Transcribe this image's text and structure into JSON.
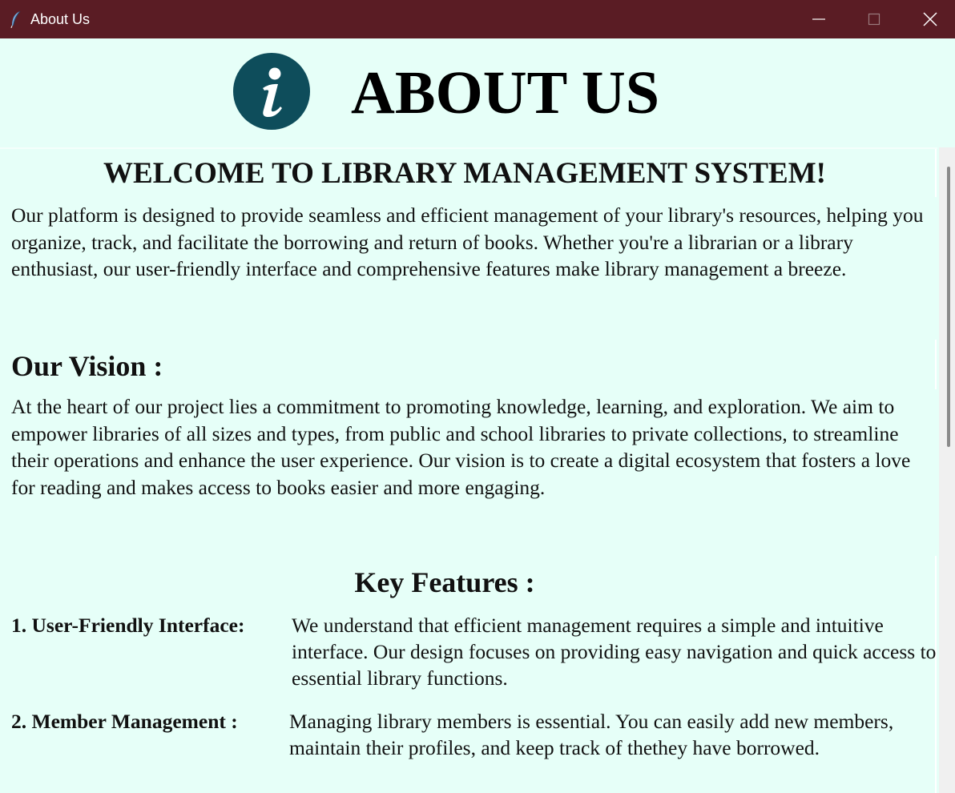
{
  "window": {
    "title": "About Us",
    "icons": {
      "app": "feather-icon",
      "minimize": "minimize-icon",
      "maximize": "maximize-icon",
      "close": "close-icon"
    },
    "titlebar_color": "#5a1c24"
  },
  "header": {
    "icon": "info-icon",
    "icon_color": "#0e4d5b",
    "title": "ABOUT US"
  },
  "content": {
    "welcome_heading": "WELCOME TO LIBRARY MANAGEMENT SYSTEM!",
    "intro": "Our platform is designed to provide seamless and efficient management of your library's resources, helping you organize, track, and facilitate the borrowing and return of books. Whether you're a librarian or a library enthusiast, our user-friendly interface and comprehensive features make library management a breeze.",
    "vision_heading": "Our Vision :",
    "vision_text": "At the heart of our project lies a commitment to promoting knowledge, learning, and exploration. We aim to empower libraries of all sizes and types, from public and school libraries to private collections, to streamline their operations and enhance the user experience. Our vision is to create a digital ecosystem that fosters a love for reading and makes access to books easier and more engaging.",
    "features_heading": "Key Features :",
    "features": [
      {
        "label": "1. User-Friendly Interface:",
        "text": "We understand that efficient management requires a simple and intuitive interface. Our design focuses on providing easy navigation and quick access to essential library functions."
      },
      {
        "label": "2. Member Management :",
        "text": "Managing library members is essential. You can easily add new members, maintain their profiles, and keep track of thethey have borrowed."
      }
    ]
  },
  "background_color": "#e6fff8"
}
